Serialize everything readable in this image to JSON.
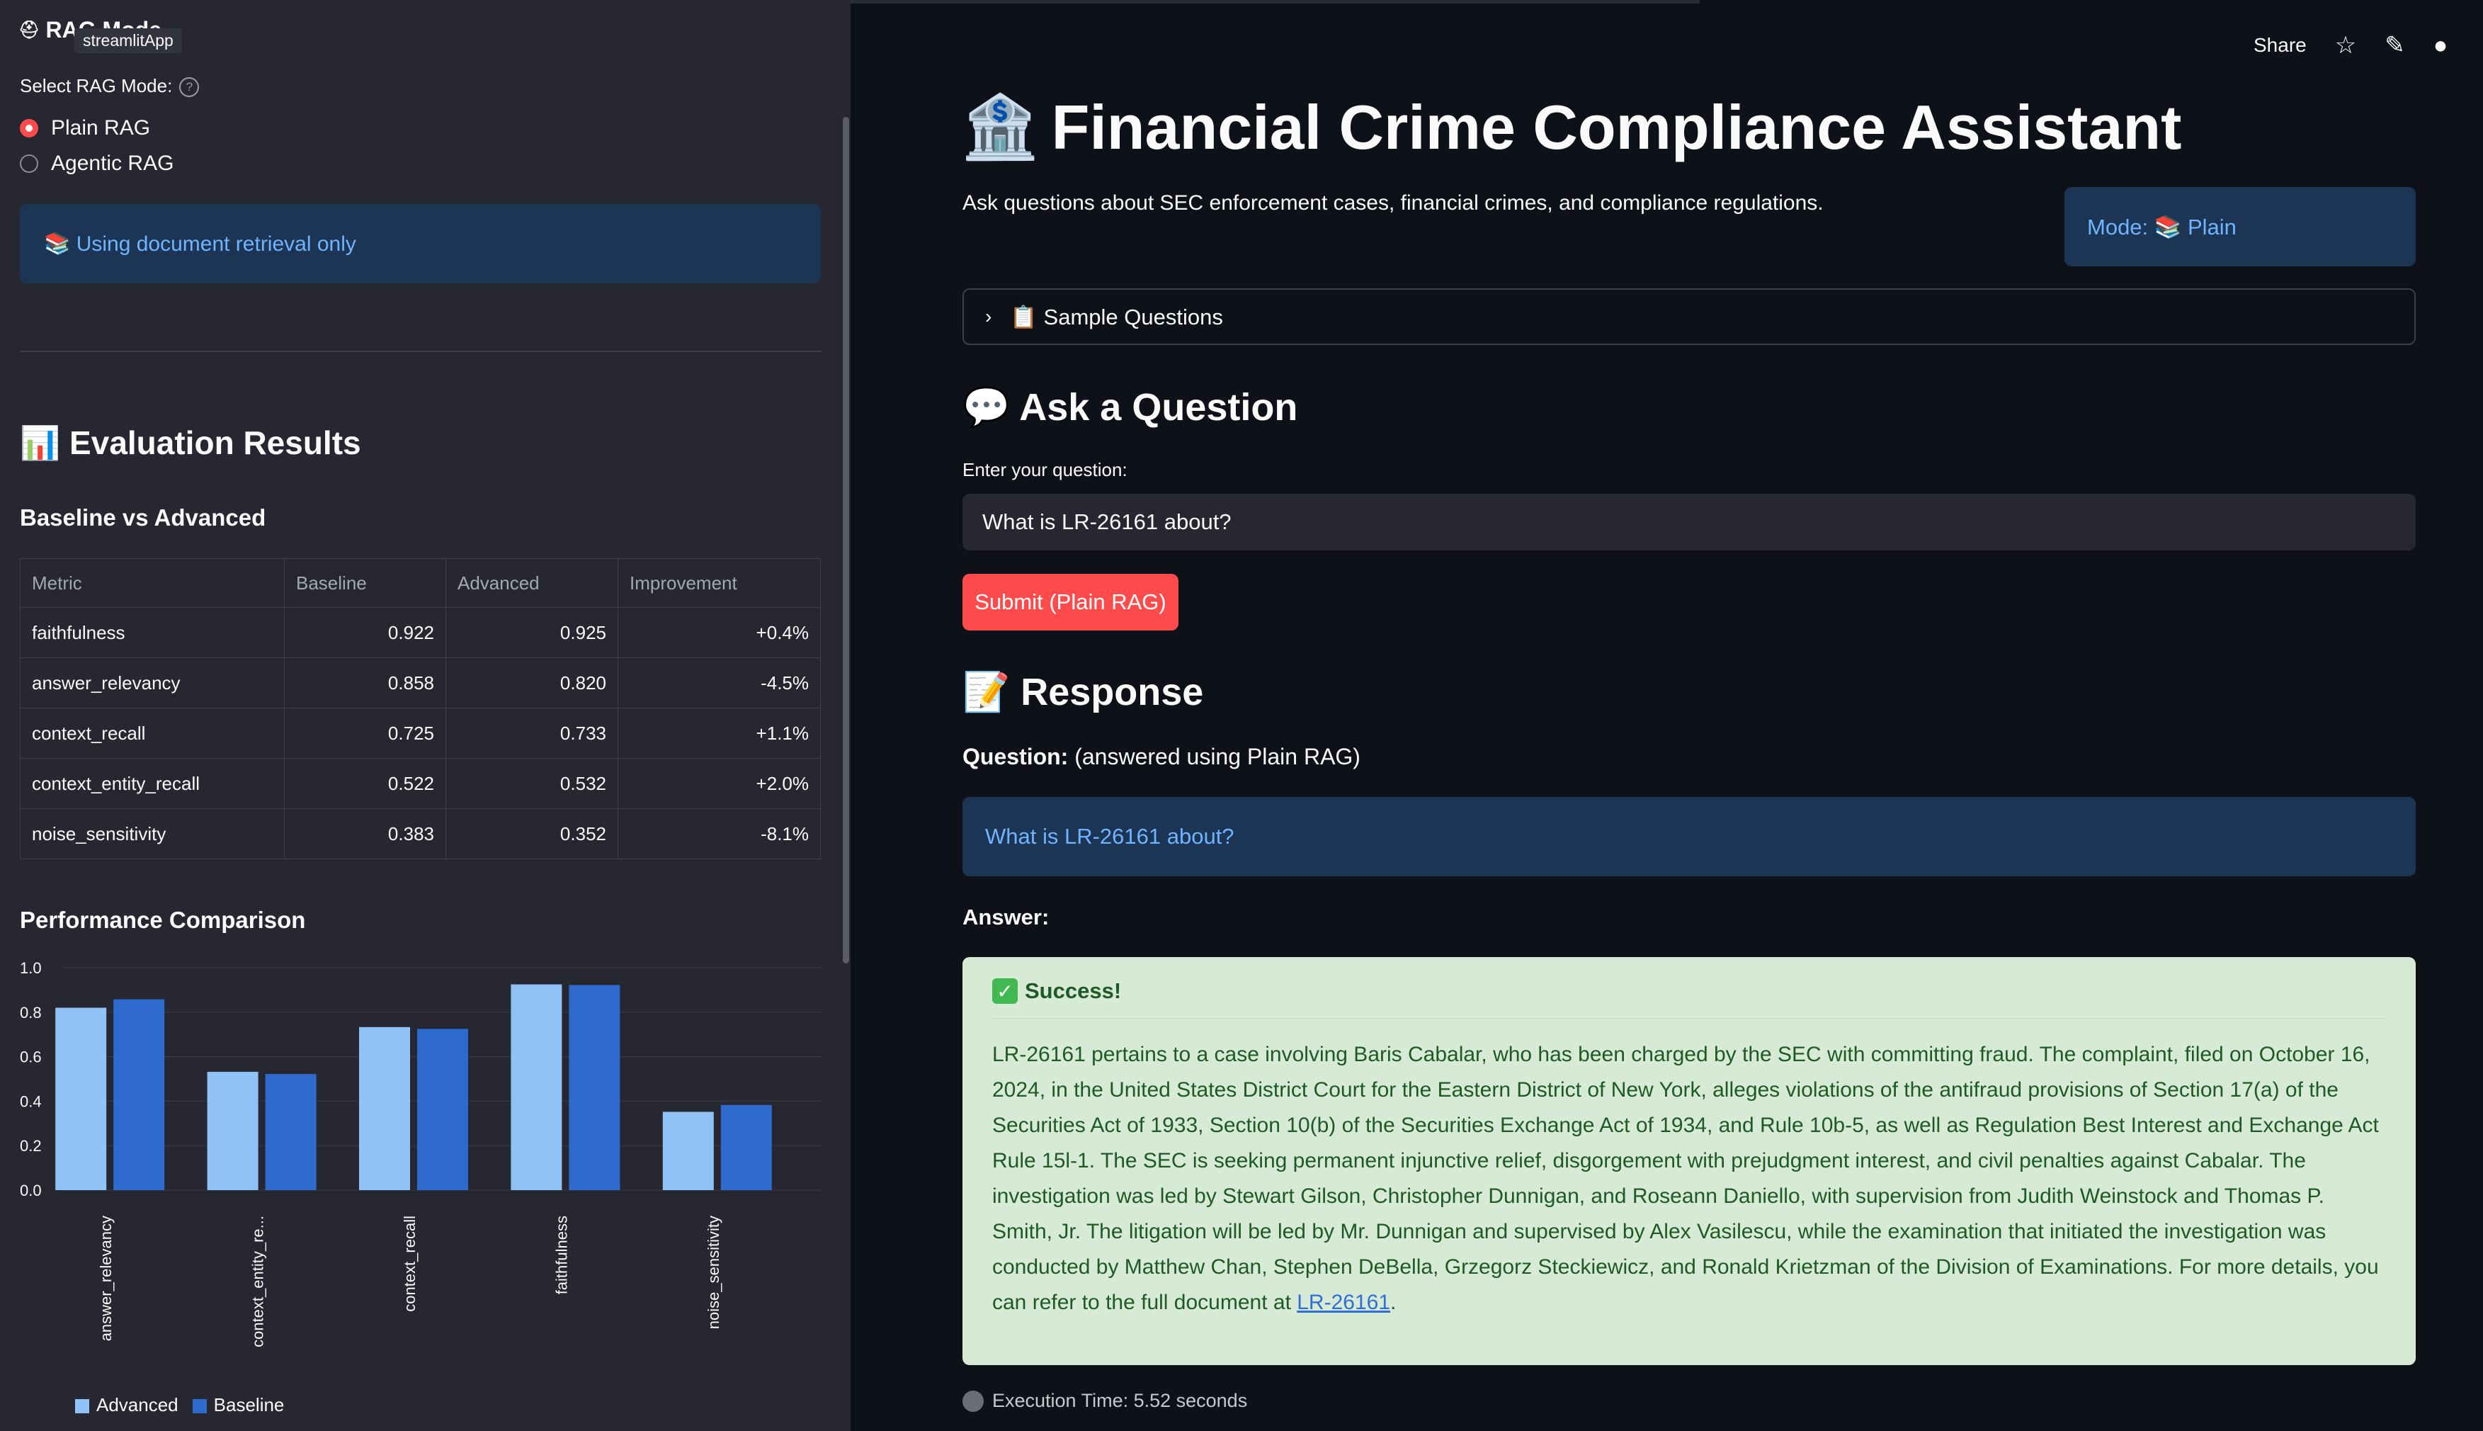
{
  "sidebar": {
    "app_title": "RAG Mode",
    "tooltip": "streamlitApp",
    "select_label": "Select RAG Mode:",
    "options": [
      "Plain RAG",
      "Agentic RAG"
    ],
    "selected": "Plain RAG",
    "info_text": "📚 Using document retrieval only",
    "eval_title": "📊 Evaluation Results",
    "table_title": "Baseline vs Advanced",
    "table": {
      "headers": [
        "Metric",
        "Baseline",
        "Advanced",
        "Improvement"
      ],
      "rows": [
        [
          "faithfulness",
          "0.922",
          "0.925",
          "+0.4%"
        ],
        [
          "answer_relevancy",
          "0.858",
          "0.820",
          "-4.5%"
        ],
        [
          "context_recall",
          "0.725",
          "0.733",
          "+1.1%"
        ],
        [
          "context_entity_recall",
          "0.522",
          "0.532",
          "+2.0%"
        ],
        [
          "noise_sensitivity",
          "0.383",
          "0.352",
          "-8.1%"
        ]
      ]
    },
    "chart_title": "Performance Comparison"
  },
  "chart_data": {
    "type": "bar",
    "categories": [
      "answer_relevancy",
      "context_entity_re...",
      "context_recall",
      "faithfulness",
      "noise_sensitivity"
    ],
    "series": [
      {
        "name": "Advanced",
        "values": [
          0.82,
          0.532,
          0.733,
          0.925,
          0.352
        ],
        "color": "#8fc3f7"
      },
      {
        "name": "Baseline",
        "values": [
          0.858,
          0.522,
          0.725,
          0.922,
          0.383
        ],
        "color": "#2f6bcf"
      }
    ],
    "ylim": [
      0,
      1.0
    ],
    "yticks": [
      "0.0",
      "0.2",
      "0.4",
      "0.6",
      "0.8",
      "1.0"
    ],
    "grid": true,
    "legend": "bottom-left"
  },
  "header": {
    "share": "Share",
    "icons": [
      "star-icon",
      "pencil-icon",
      "github-icon"
    ]
  },
  "main": {
    "title": "Financial Crime Compliance Assistant",
    "intro": "Ask questions about SEC enforcement cases, financial crimes, and compliance regulations.",
    "mode_box": "Mode: 📚 Plain",
    "expander": "📋 Sample Questions",
    "ask_title": "💬 Ask a Question",
    "input_label": "Enter your question:",
    "input_value": "What is LR-26161 about?",
    "submit_label": "Submit (Plain RAG)",
    "response_title": "📝 Response",
    "question_bold": "Question:",
    "question_suffix": "(answered using Plain RAG)",
    "question_text": "What is LR-26161 about?",
    "answer_label": "Answer:",
    "success_head": "Success!",
    "answer_body": "LR-26161 pertains to a case involving Baris Cabalar, who has been charged by the SEC with committing fraud. The complaint, filed on October 16, 2024, in the United States District Court for the Eastern District of New York, alleges violations of the antifraud provisions of Section 17(a) of the Securities Act of 1933, Section 10(b) of the Securities Exchange Act of 1934, and Rule 10b-5, as well as Regulation Best Interest and Exchange Act Rule 15l-1. The SEC is seeking permanent injunctive relief, disgorgement with prejudgment interest, and civil penalties against Cabalar. The investigation was led by Stewart Gilson, Christopher Dunnigan, and Roseann Daniello, with supervision from Judith Weinstock and Thomas P. Smith, Jr. The litigation will be led by Mr. Dunnigan and supervised by Alex Vasilescu, while the examination that initiated the investigation was conducted by Matthew Chan, Stephen DeBella, Grzegorz Steckiewicz, and Ronald Krietzman of the Division of Examinations. For more details, you can refer to the full document at",
    "answer_link": "LR-26161",
    "answer_end": ".",
    "exec_time": "Execution Time: 5.52 seconds"
  },
  "colors": {
    "accent": "#ff4b4b",
    "info_bg": "#1c3554",
    "info_text": "#6fb4ff",
    "success_bg": "#d7ead6"
  }
}
